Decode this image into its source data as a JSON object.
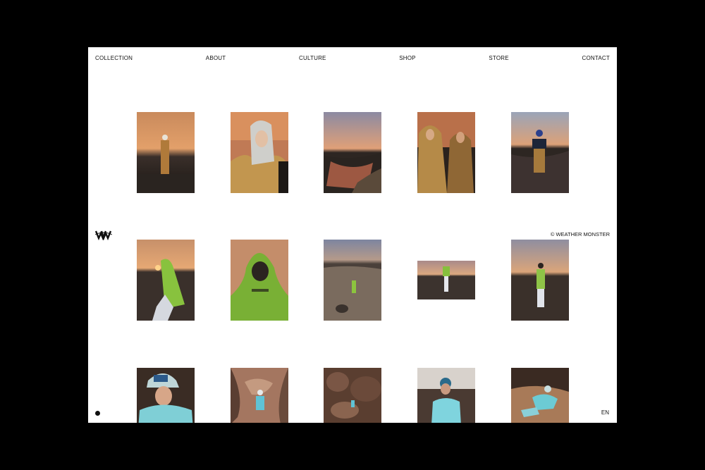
{
  "nav": {
    "items": [
      "COLLECTION",
      "ABOUT",
      "CULTURE",
      "SHOP",
      "STORE",
      "CONTACT"
    ]
  },
  "brand": {
    "copyright": "© WEATHER MONSTER",
    "language": "EN"
  },
  "colors": {
    "background": "#000000",
    "page": "#ffffff",
    "text": "#111111"
  },
  "gallery": {
    "rows": [
      [
        "sunset-figure-tan-jumpsuit",
        "white-hood-portrait",
        "river-landscape-dusk",
        "two-figures-tan-jackets",
        "figure-blue-cap-tan-outfit"
      ],
      [
        "green-jacket-hooded-sunset",
        "green-hood-closeup",
        "rocky-landscape-green-figure",
        "green-figure-wide-shot",
        "green-vest-figure-sunset"
      ],
      [
        "cyan-cap-portrait",
        "canyon-cyan-figure",
        "rock-formations-small-figure",
        "cyan-jacket-portrait",
        "cyan-figure-on-rocks"
      ]
    ]
  }
}
